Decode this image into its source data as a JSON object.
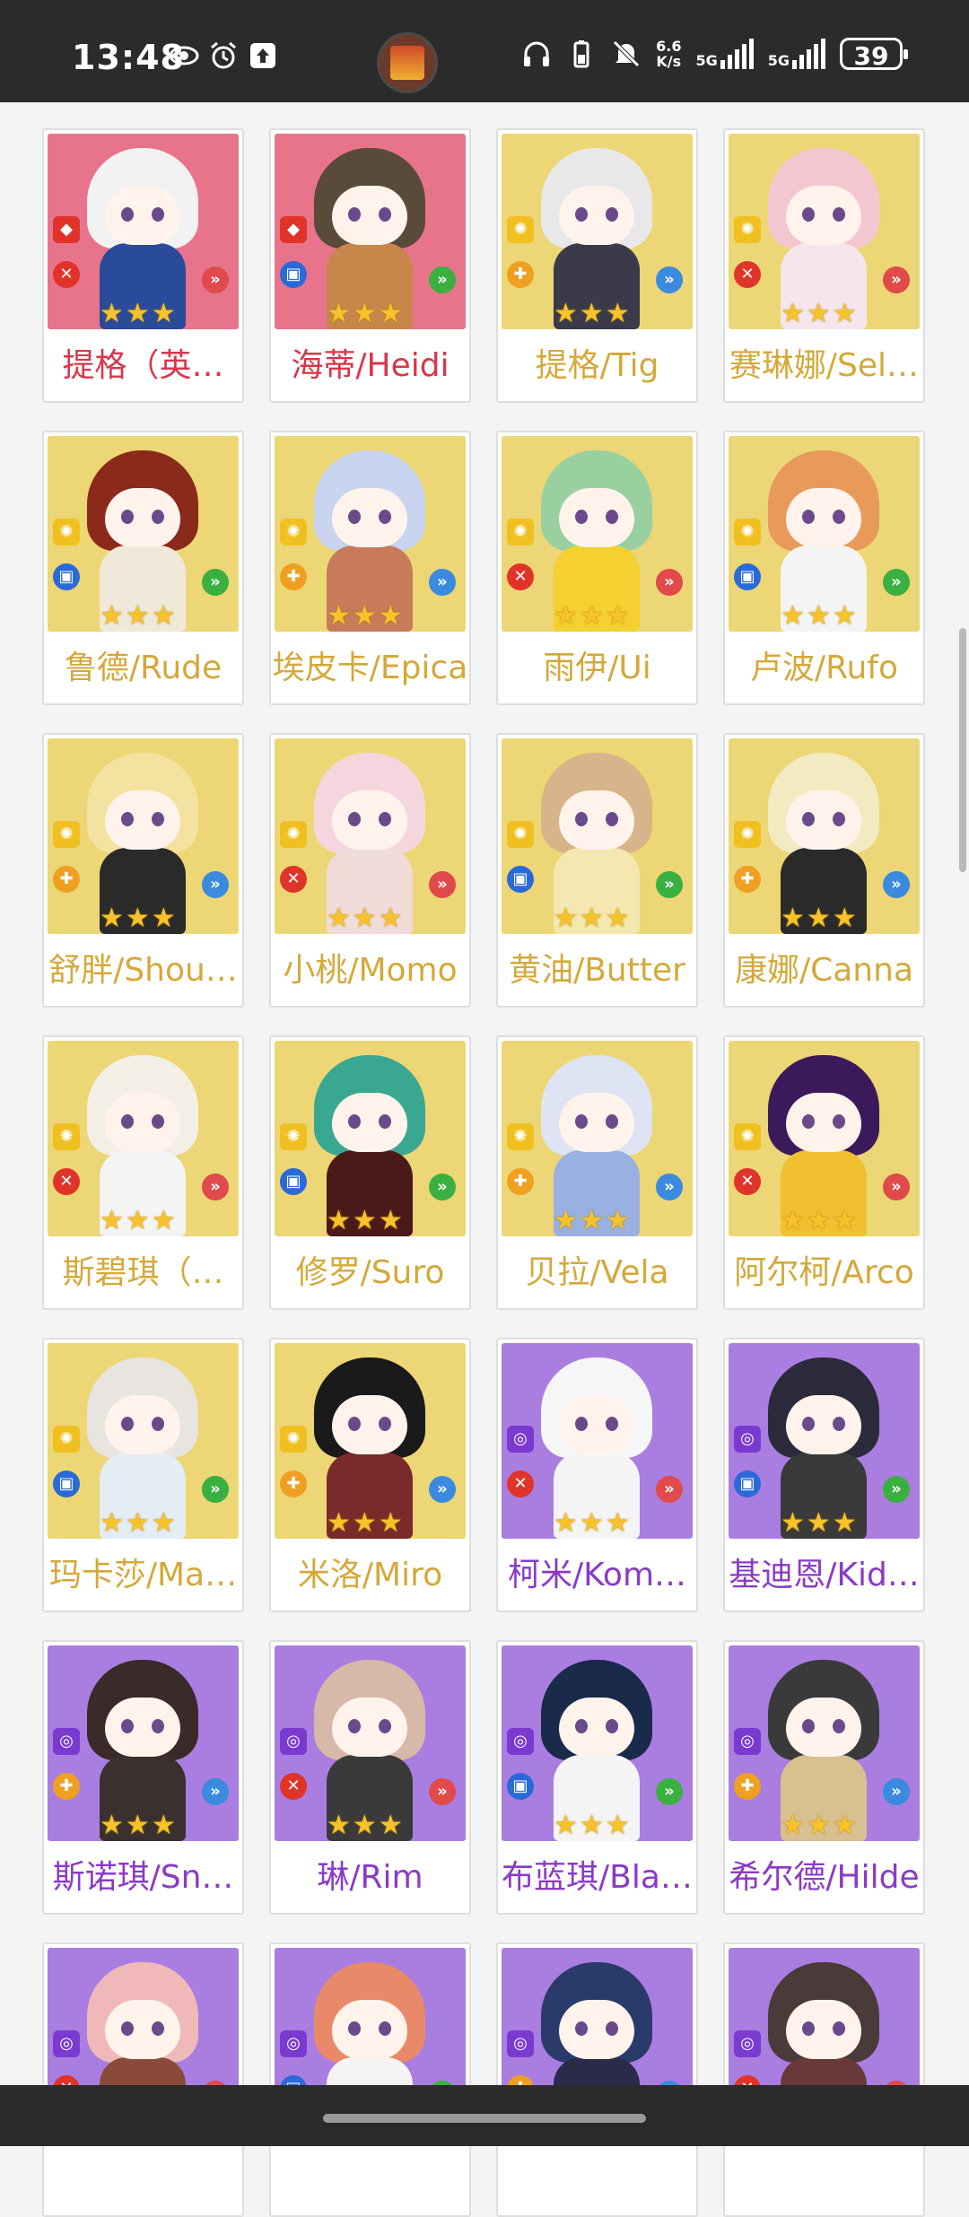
{
  "status_bar": {
    "time": "13:48",
    "net_speed_top": "6.6",
    "net_speed_bottom": "K/s",
    "sim1": "5G",
    "sim2": "5G",
    "battery": "39",
    "icons": [
      "eye-icon",
      "alarm-icon",
      "upload-icon",
      "headphones-icon",
      "battery-saver-icon",
      "mute-icon",
      "signal-icon",
      "signal-icon"
    ]
  },
  "colors": {
    "rarity_pink": "#e8748c",
    "rarity_yellow": "#ecd675",
    "rarity_purple": "#a97ee0",
    "name_red": "#d8364a",
    "name_gold": "#d4a93a",
    "name_violet": "#8a3ac8",
    "star": "#f7c22a"
  },
  "characters": [
    {
      "name": "提格（英…",
      "rarity": "pink",
      "stars": 3
    },
    {
      "name": "海蒂/Heidi",
      "rarity": "pink",
      "stars": 3
    },
    {
      "name": "提格/Tig",
      "rarity": "yellow",
      "stars": 3
    },
    {
      "name": "赛琳娜/Sel…",
      "rarity": "yellow",
      "stars": 3
    },
    {
      "name": "鲁德/Rude",
      "rarity": "yellow",
      "stars": 3
    },
    {
      "name": "埃皮卡/Epica",
      "rarity": "yellow",
      "stars": 3
    },
    {
      "name": "雨伊/Ui",
      "rarity": "yellow",
      "stars": 3
    },
    {
      "name": "卢波/Rufo",
      "rarity": "yellow",
      "stars": 3
    },
    {
      "name": "舒胖/Shou…",
      "rarity": "yellow",
      "stars": 3
    },
    {
      "name": "小桃/Momo",
      "rarity": "yellow",
      "stars": 3
    },
    {
      "name": "黄油/Butter",
      "rarity": "yellow",
      "stars": 3
    },
    {
      "name": "康娜/Canna",
      "rarity": "yellow",
      "stars": 3
    },
    {
      "name": "斯碧琪（…",
      "rarity": "yellow",
      "stars": 3
    },
    {
      "name": "修罗/Suro",
      "rarity": "yellow",
      "stars": 3
    },
    {
      "name": "贝拉/Vela",
      "rarity": "yellow",
      "stars": 3
    },
    {
      "name": "阿尔柯/Arco",
      "rarity": "yellow",
      "stars": 3
    },
    {
      "name": "玛卡莎/Ma…",
      "rarity": "yellow",
      "stars": 3
    },
    {
      "name": "米洛/Miro",
      "rarity": "yellow",
      "stars": 3
    },
    {
      "name": "柯米/Kom…",
      "rarity": "purple",
      "stars": 3
    },
    {
      "name": "基迪恩/Kid…",
      "rarity": "purple",
      "stars": 3
    },
    {
      "name": "斯诺琪/Sn…",
      "rarity": "purple",
      "stars": 3
    },
    {
      "name": "琳/Rim",
      "rarity": "purple",
      "stars": 3
    },
    {
      "name": "布蓝琪/Bla…",
      "rarity": "purple",
      "stars": 3
    },
    {
      "name": "希尔德/Hilde",
      "rarity": "purple",
      "stars": 3
    },
    {
      "name": "",
      "rarity": "purple",
      "stars": 0
    },
    {
      "name": "",
      "rarity": "purple",
      "stars": 0
    },
    {
      "name": "",
      "rarity": "purple",
      "stars": 0
    },
    {
      "name": "",
      "rarity": "purple",
      "stars": 0
    }
  ]
}
